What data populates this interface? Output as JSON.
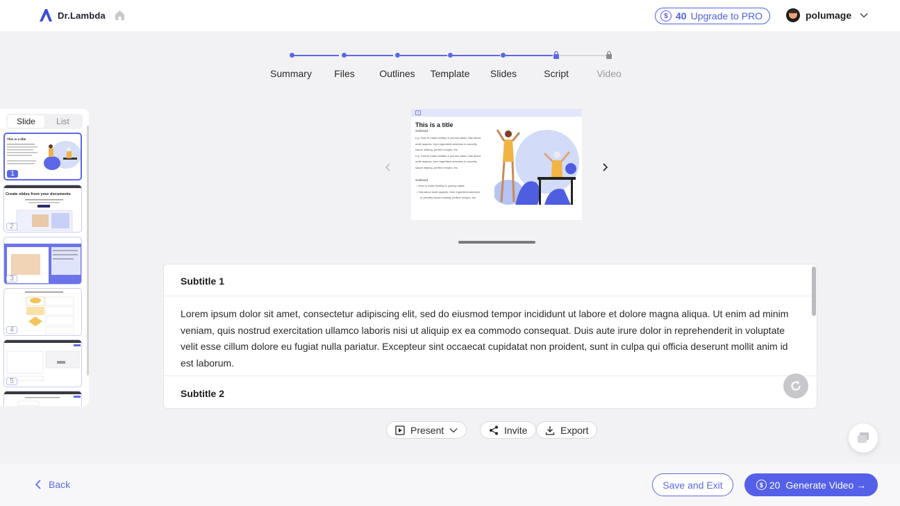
{
  "header": {
    "brand": "Dr.Lambda",
    "credits": {
      "symbol": "$",
      "count": "40",
      "upgrade_label": "Upgrade to PRO"
    },
    "user": {
      "name": "polumage"
    }
  },
  "stepper": {
    "steps": [
      {
        "label": "Summary",
        "state": "done"
      },
      {
        "label": "Files",
        "state": "done"
      },
      {
        "label": "Outlines",
        "state": "done"
      },
      {
        "label": "Template",
        "state": "done"
      },
      {
        "label": "Slides",
        "state": "done"
      },
      {
        "label": "Script",
        "state": "current-locked"
      },
      {
        "label": "Video",
        "state": "locked"
      }
    ]
  },
  "thumbnails": {
    "toggle": {
      "slide": "Slide",
      "list": "List",
      "active": "Slide"
    },
    "items": [
      {
        "num": "1",
        "title": "This is a title",
        "selected": true
      },
      {
        "num": "2",
        "title": "Create slides from your documents",
        "selected": false
      },
      {
        "num": "3",
        "title": "",
        "selected": false
      },
      {
        "num": "4",
        "title": "",
        "selected": false
      },
      {
        "num": "5",
        "title": "",
        "selected": false
      }
    ]
  },
  "preview": {
    "badge": "1",
    "title": "This is a title",
    "subhead": "Subhead",
    "lines": [
      "e.g. How to make healthy & yummy salad. Talk about",
      "multi aspects, from ingredient selection to secretly",
      "sauce making, perfect recipes, etc.",
      "e.g. How to make healthy & yummy salad. Talk about",
      "multi aspects, from ingredient selection to secretly",
      "sauce making, perfect recipes, etc."
    ],
    "subhead2": "Subhead",
    "bullets": [
      "How to make healthy & yummy salad.",
      "Talk about multi aspects, from ingredient selection",
      "to secretly sauce making, perfect recipes, etc."
    ]
  },
  "script": {
    "subtitle1": "Subtitle 1",
    "paragraph1": "Lorem ipsum dolor sit amet, consectetur adipiscing elit, sed do eiusmod tempor incididunt ut labore et dolore magna aliqua. Ut enim ad minim veniam, quis nostrud exercitation ullamco laboris nisi ut aliquip ex ea commodo consequat. Duis aute irure dolor in reprehenderit in voluptate velit esse cillum dolore eu fugiat nulla pariatur. Excepteur sint occaecat cupidatat non proident, sunt in culpa qui officia deserunt mollit anim id est laborum.",
    "subtitle2": "Subtitle 2"
  },
  "toolbar": {
    "present": "Present",
    "invite": "Invite",
    "export": "Export"
  },
  "footer": {
    "back": "Back",
    "save_exit": "Save and Exit",
    "generate_cost": "20",
    "generate_label": "Generate Video →"
  },
  "colors": {
    "accent": "#5b67e6",
    "background": "#f2f2f4"
  }
}
